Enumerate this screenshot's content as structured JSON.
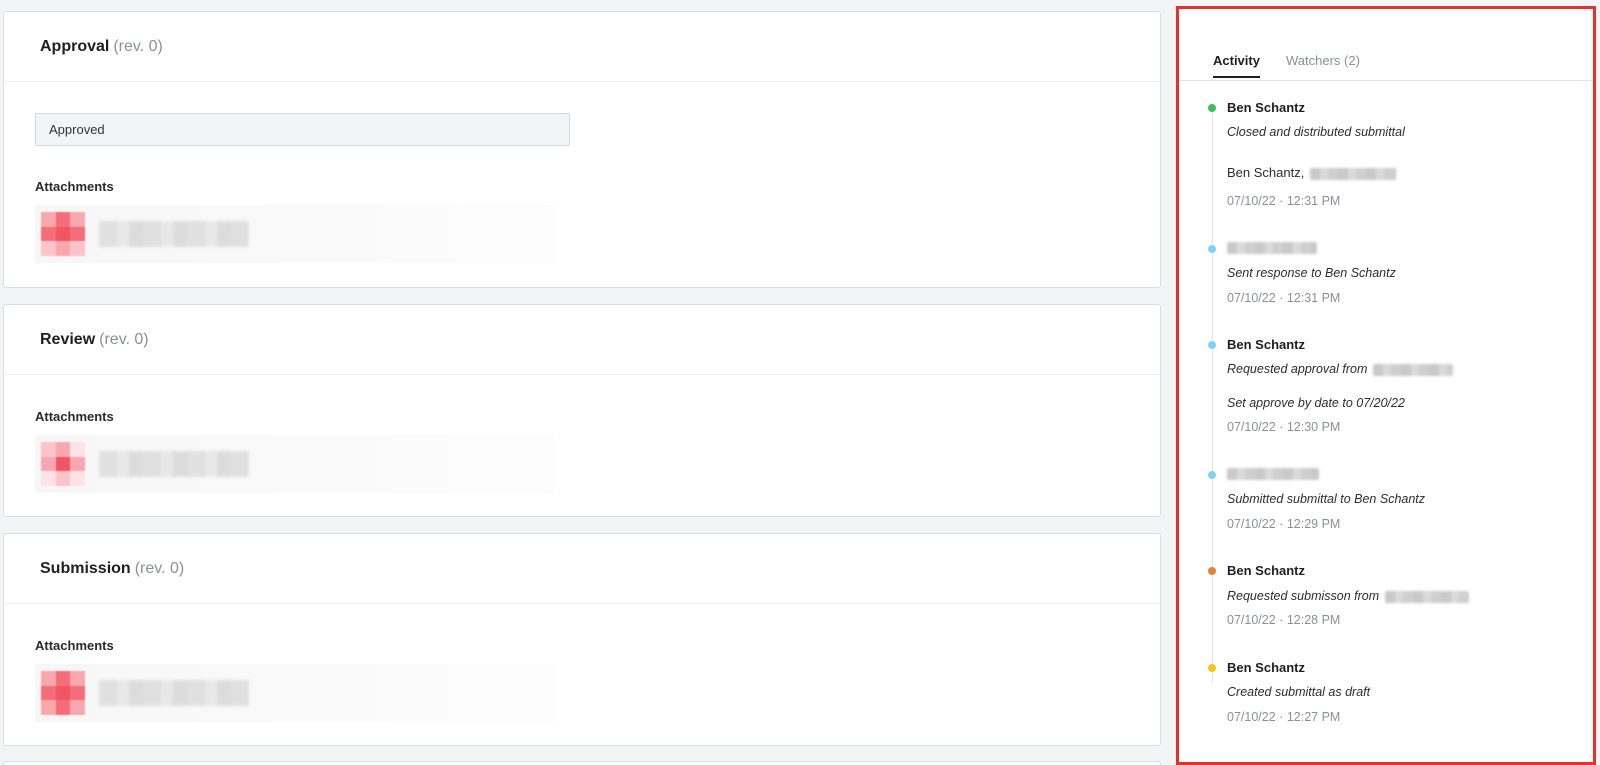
{
  "cards": {
    "approval": {
      "title": "Approval",
      "rev": "(rev. 0)",
      "status": "Approved",
      "attachments_label": "Attachments"
    },
    "review": {
      "title": "Review",
      "rev": "(rev. 0)",
      "attachments_label": "Attachments"
    },
    "submission": {
      "title": "Submission",
      "rev": "(rev. 0)",
      "attachments_label": "Attachments"
    }
  },
  "activity_panel": {
    "tabs": {
      "activity": "Activity",
      "watchers": "Watchers (2)"
    },
    "events": [
      {
        "author": "Ben Schantz",
        "description": "Closed and distributed submittal",
        "distribution_prefix": "Ben Schantz,",
        "date": "07/10/22",
        "separator": "·",
        "time": "12:31 PM",
        "dot_color": "#3ebc5b"
      },
      {
        "author": "",
        "description": "Sent response to Ben Schantz",
        "date": "07/10/22",
        "separator": "·",
        "time": "12:31 PM",
        "dot_color": "#7fd3f0"
      },
      {
        "author": "Ben Schantz",
        "description": "Requested approval from",
        "extra": "Set approve by date to 07/20/22",
        "date": "07/10/22",
        "separator": "·",
        "time": "12:30 PM",
        "dot_color": "#7fd3f0"
      },
      {
        "author": "",
        "description": "Submitted submittal to Ben Schantz",
        "date": "07/10/22",
        "separator": "·",
        "time": "12:29 PM",
        "dot_color": "#7fd3f0"
      },
      {
        "author": "Ben Schantz",
        "description": "Requested submisson from",
        "date": "07/10/22",
        "separator": "·",
        "time": "12:28 PM",
        "dot_color": "#e8803a"
      },
      {
        "author": "Ben Schantz",
        "description": "Created submittal as draft",
        "date": "07/10/22",
        "separator": "·",
        "time": "12:27 PM",
        "dot_color": "#f5c518"
      }
    ]
  }
}
